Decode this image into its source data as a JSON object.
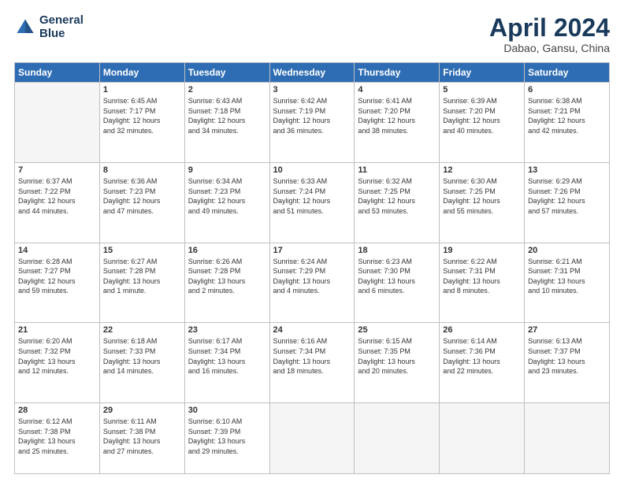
{
  "logo": {
    "line1": "General",
    "line2": "Blue"
  },
  "header": {
    "month": "April 2024",
    "location": "Dabao, Gansu, China"
  },
  "weekdays": [
    "Sunday",
    "Monday",
    "Tuesday",
    "Wednesday",
    "Thursday",
    "Friday",
    "Saturday"
  ],
  "weeks": [
    [
      {
        "day": "",
        "info": ""
      },
      {
        "day": "1",
        "info": "Sunrise: 6:45 AM\nSunset: 7:17 PM\nDaylight: 12 hours\nand 32 minutes."
      },
      {
        "day": "2",
        "info": "Sunrise: 6:43 AM\nSunset: 7:18 PM\nDaylight: 12 hours\nand 34 minutes."
      },
      {
        "day": "3",
        "info": "Sunrise: 6:42 AM\nSunset: 7:19 PM\nDaylight: 12 hours\nand 36 minutes."
      },
      {
        "day": "4",
        "info": "Sunrise: 6:41 AM\nSunset: 7:20 PM\nDaylight: 12 hours\nand 38 minutes."
      },
      {
        "day": "5",
        "info": "Sunrise: 6:39 AM\nSunset: 7:20 PM\nDaylight: 12 hours\nand 40 minutes."
      },
      {
        "day": "6",
        "info": "Sunrise: 6:38 AM\nSunset: 7:21 PM\nDaylight: 12 hours\nand 42 minutes."
      }
    ],
    [
      {
        "day": "7",
        "info": "Sunrise: 6:37 AM\nSunset: 7:22 PM\nDaylight: 12 hours\nand 44 minutes."
      },
      {
        "day": "8",
        "info": "Sunrise: 6:36 AM\nSunset: 7:23 PM\nDaylight: 12 hours\nand 47 minutes."
      },
      {
        "day": "9",
        "info": "Sunrise: 6:34 AM\nSunset: 7:23 PM\nDaylight: 12 hours\nand 49 minutes."
      },
      {
        "day": "10",
        "info": "Sunrise: 6:33 AM\nSunset: 7:24 PM\nDaylight: 12 hours\nand 51 minutes."
      },
      {
        "day": "11",
        "info": "Sunrise: 6:32 AM\nSunset: 7:25 PM\nDaylight: 12 hours\nand 53 minutes."
      },
      {
        "day": "12",
        "info": "Sunrise: 6:30 AM\nSunset: 7:25 PM\nDaylight: 12 hours\nand 55 minutes."
      },
      {
        "day": "13",
        "info": "Sunrise: 6:29 AM\nSunset: 7:26 PM\nDaylight: 12 hours\nand 57 minutes."
      }
    ],
    [
      {
        "day": "14",
        "info": "Sunrise: 6:28 AM\nSunset: 7:27 PM\nDaylight: 12 hours\nand 59 minutes."
      },
      {
        "day": "15",
        "info": "Sunrise: 6:27 AM\nSunset: 7:28 PM\nDaylight: 13 hours\nand 1 minute."
      },
      {
        "day": "16",
        "info": "Sunrise: 6:26 AM\nSunset: 7:28 PM\nDaylight: 13 hours\nand 2 minutes."
      },
      {
        "day": "17",
        "info": "Sunrise: 6:24 AM\nSunset: 7:29 PM\nDaylight: 13 hours\nand 4 minutes."
      },
      {
        "day": "18",
        "info": "Sunrise: 6:23 AM\nSunset: 7:30 PM\nDaylight: 13 hours\nand 6 minutes."
      },
      {
        "day": "19",
        "info": "Sunrise: 6:22 AM\nSunset: 7:31 PM\nDaylight: 13 hours\nand 8 minutes."
      },
      {
        "day": "20",
        "info": "Sunrise: 6:21 AM\nSunset: 7:31 PM\nDaylight: 13 hours\nand 10 minutes."
      }
    ],
    [
      {
        "day": "21",
        "info": "Sunrise: 6:20 AM\nSunset: 7:32 PM\nDaylight: 13 hours\nand 12 minutes."
      },
      {
        "day": "22",
        "info": "Sunrise: 6:18 AM\nSunset: 7:33 PM\nDaylight: 13 hours\nand 14 minutes."
      },
      {
        "day": "23",
        "info": "Sunrise: 6:17 AM\nSunset: 7:34 PM\nDaylight: 13 hours\nand 16 minutes."
      },
      {
        "day": "24",
        "info": "Sunrise: 6:16 AM\nSunset: 7:34 PM\nDaylight: 13 hours\nand 18 minutes."
      },
      {
        "day": "25",
        "info": "Sunrise: 6:15 AM\nSunset: 7:35 PM\nDaylight: 13 hours\nand 20 minutes."
      },
      {
        "day": "26",
        "info": "Sunrise: 6:14 AM\nSunset: 7:36 PM\nDaylight: 13 hours\nand 22 minutes."
      },
      {
        "day": "27",
        "info": "Sunrise: 6:13 AM\nSunset: 7:37 PM\nDaylight: 13 hours\nand 23 minutes."
      }
    ],
    [
      {
        "day": "28",
        "info": "Sunrise: 6:12 AM\nSunset: 7:38 PM\nDaylight: 13 hours\nand 25 minutes."
      },
      {
        "day": "29",
        "info": "Sunrise: 6:11 AM\nSunset: 7:38 PM\nDaylight: 13 hours\nand 27 minutes."
      },
      {
        "day": "30",
        "info": "Sunrise: 6:10 AM\nSunset: 7:39 PM\nDaylight: 13 hours\nand 29 minutes."
      },
      {
        "day": "",
        "info": ""
      },
      {
        "day": "",
        "info": ""
      },
      {
        "day": "",
        "info": ""
      },
      {
        "day": "",
        "info": ""
      }
    ]
  ]
}
